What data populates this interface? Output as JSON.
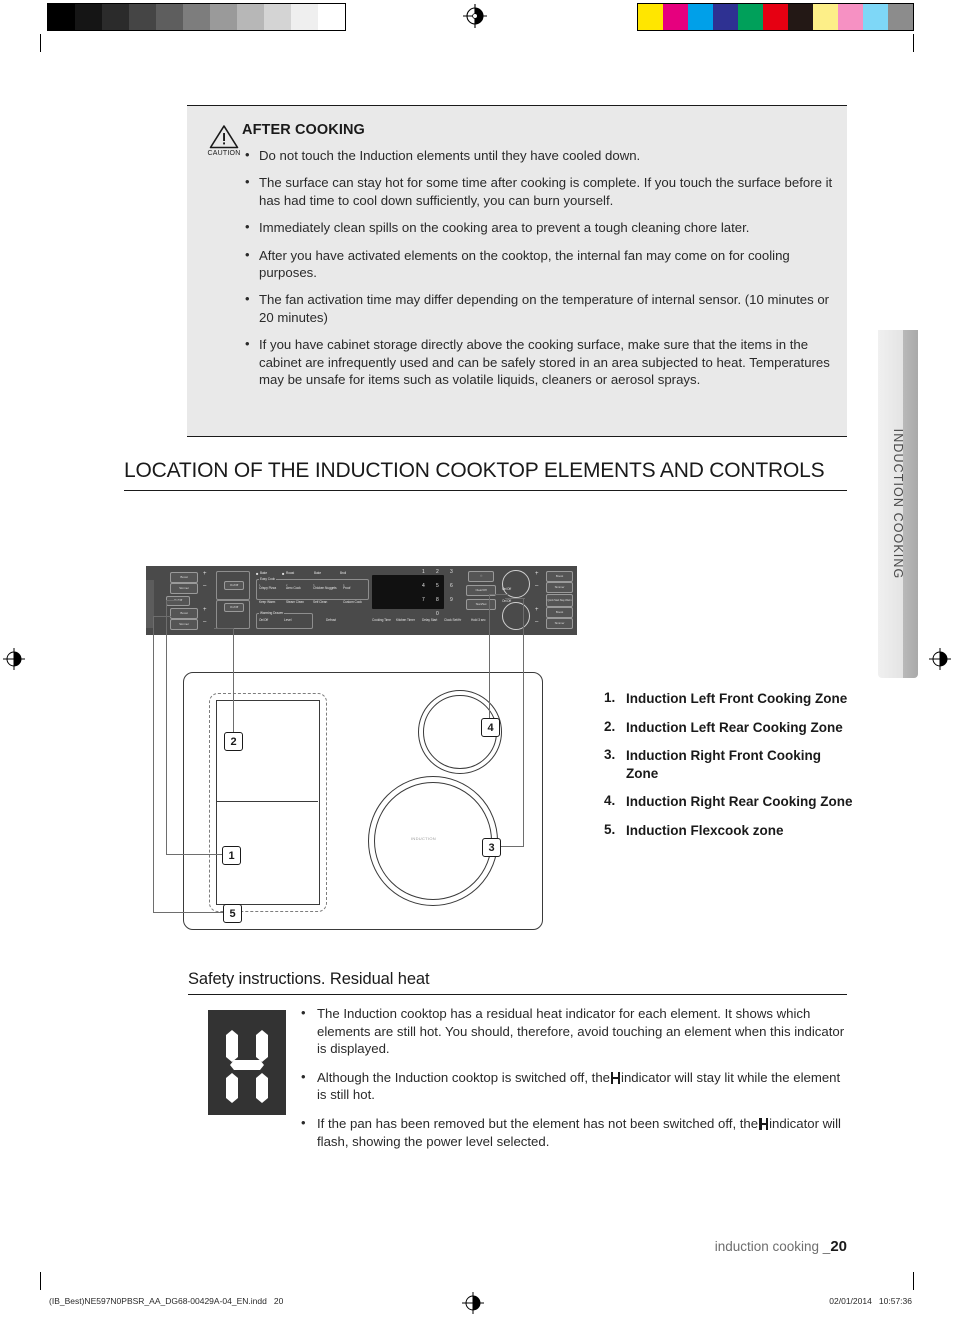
{
  "print_marks": {
    "grayscale_steps": [
      "#000000",
      "#151515",
      "#2b2b2b",
      "#454545",
      "#5e5e5e",
      "#7d7d7d",
      "#9a9a9a",
      "#b7b7b7",
      "#d4d4d4",
      "#efefef",
      "#ffffff"
    ],
    "color_patches": [
      "#ffe600",
      "#e6007e",
      "#00a0e9",
      "#2e3192",
      "#00a05a",
      "#e60012",
      "#231815",
      "#fdef88",
      "#f691c3",
      "#7ed7f7",
      "#8c8c8c"
    ],
    "registration_icon": "registration-target-icon"
  },
  "caution": {
    "icon_name": "warning-triangle-icon",
    "icon_caption": "CAUTION",
    "title": "AFTER COOKING",
    "bullets": [
      "Do not touch the Induction elements until they have cooled down.",
      "The surface can stay hot for some time after cooking is complete. If you touch the surface before it has had time to cool down sufficiently, you can burn yourself.",
      "Immediately clean spills on the cooking area to prevent a tough cleaning chore later.",
      "After you have activated elements on the cooktop, the internal fan may come on for cooling purposes.",
      "The fan activation time may differ depending on the temperature of internal sensor. (10 minutes or 20 minutes)",
      "If you have cabinet storage directly above the cooking surface, make sure that the items in the cabinet are infrequently used and can be safely stored in an area subjected to heat. Temperatures may be unsafe for items such as volatile liquids, cleaners or aerosol sprays."
    ]
  },
  "section": {
    "heading": "LOCATION OF THE INDUCTION COOKTOP ELEMENTS AND CONTROLS"
  },
  "side_tab": {
    "label": "INDUCTION COOKING"
  },
  "control_panel": {
    "left_group": {
      "rear_boost": "Boost",
      "rear_simmer": "Simmer",
      "plus": "+",
      "minus": "–",
      "onoff": "On/Off",
      "front_boost": "Boost",
      "front_simmer": "Simmer"
    },
    "flex_group": {
      "upper_onoff": "On/Off",
      "lower_onoff": "On/Off"
    },
    "oven_top_row": [
      "Bake",
      "Roast",
      "Bake",
      "Broil"
    ],
    "easy_cook": {
      "title": "Easy Cook",
      "items": [
        "Crispy Pizza",
        "Aero Cook",
        "Chicken Nuggets",
        "Proof"
      ],
      "numbers": [
        "1",
        "2",
        "3",
        "4"
      ]
    },
    "mid_row": [
      "Keep Warm",
      "Steam Clean",
      "Self Clean",
      "Custom Cook"
    ],
    "warming_drawer": {
      "title": "Warming Drawer",
      "onoff": "On/Off",
      "level": "Level"
    },
    "defrost": "Defrost",
    "bottom_row": [
      "Cooking Time",
      "Kitchen Timer",
      "Delay Start",
      "Clock Set/Hr"
    ],
    "keypad": [
      "1",
      "2",
      "3",
      "4",
      "5",
      "6",
      "7",
      "8",
      "9",
      "0"
    ],
    "lock_icon": "lock-icon",
    "lock_label": "Hold 3 sec",
    "clear_off": "Clear/Off",
    "start_set": "Start/Set",
    "right_group": {
      "rear_onoff": "On/Off",
      "front_onoff": "On/Off",
      "plus": "+",
      "minus": "–",
      "rear_boost": "Boost",
      "rear_simmer": "Simmer",
      "quick_start": "Quick Start Stay Warm",
      "front_boost": "Boost",
      "front_simmer": "Simmer"
    }
  },
  "cooktop": {
    "brand_text": "INDUCTION",
    "callouts": [
      "1",
      "2",
      "3",
      "4",
      "5"
    ]
  },
  "zone_list": [
    {
      "num": "1.",
      "label": "Induction Left Front Cooking Zone"
    },
    {
      "num": "2.",
      "label": "Induction Left Rear Cooking Zone"
    },
    {
      "num": "3.",
      "label": "Induction Right Front Cooking Zone"
    },
    {
      "num": "4.",
      "label": "Induction Right Rear Cooking Zone"
    },
    {
      "num": "5.",
      "label": "Induction Flexcook zone"
    }
  ],
  "residual_heat": {
    "heading": "Safety instructions. Residual heat",
    "display_icon": "h-residual-heat-indicator",
    "bullets": [
      "The Induction cooktop has a residual heat indicator for each element. It shows which elements are still hot. You should, therefore, avoid touching an element when this indicator is displayed.",
      "Although the Induction cooktop is switched off, the",
      "indicator will stay lit while the element is still hot.",
      "If the pan has been removed but the element has not been switched off, the",
      "indicator will flash, showing the power level selected."
    ]
  },
  "footer": {
    "text": "induction cooking _",
    "page_number": "20",
    "print_left": "(IB_Best)NE597N0PBSR_AA_DG68-00429A-04_EN.indd   20",
    "print_right": "02/01/2014   10:57:36"
  }
}
